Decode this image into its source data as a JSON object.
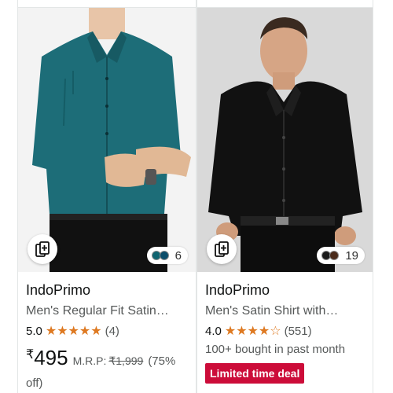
{
  "products": [
    {
      "brand": "IndoPrimo",
      "title": "Men's Regular Fit Satin…",
      "rating": "5.0",
      "stars": "★★★★★",
      "review_count": "(4)",
      "currency": "₹",
      "price": "495",
      "mrp_label": "M.R.P:",
      "mrp": "₹1,999",
      "discount": "(75%",
      "discount_cont": "off)",
      "swatch_count": "6",
      "swatch_colors": [
        "#0f6470",
        "#0b4d6a"
      ],
      "shirt_color": "#1d6d78"
    },
    {
      "brand": "IndoPrimo",
      "title": "Men's Satin Shirt with…",
      "rating": "4.0",
      "stars": "★★★★☆",
      "review_count": "(551)",
      "bought": "100+ bought in past month",
      "deal_badge": "Limited time deal",
      "swatch_count": "19",
      "swatch_colors": [
        "#1a1a1a",
        "#4a2a1a"
      ],
      "shirt_color": "#111111"
    }
  ],
  "icons": {
    "compare": "compare-cards-icon"
  },
  "colors": {
    "star": "#de7921",
    "deal": "#cc0c39",
    "secondary_text": "#565959"
  }
}
